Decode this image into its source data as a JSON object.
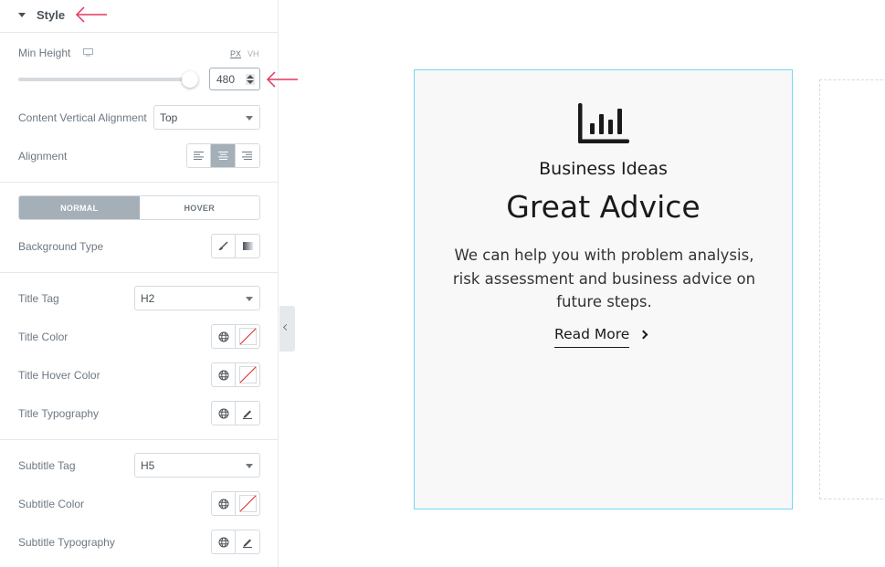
{
  "panel": {
    "section_title": "Style",
    "min_height": {
      "label": "Min Height",
      "units": [
        "PX",
        "VH"
      ],
      "active_unit": "PX",
      "value": "480",
      "slider_fraction": 0.96
    },
    "content_vertical_alignment": {
      "label": "Content Vertical Alignment",
      "value": "Top"
    },
    "alignment": {
      "label": "Alignment",
      "options": [
        "left",
        "center",
        "right"
      ],
      "active": "center"
    },
    "state_tabs": {
      "items": [
        "NORMAL",
        "HOVER"
      ],
      "active": "NORMAL"
    },
    "background_type": {
      "label": "Background Type",
      "options": [
        "classic",
        "gradient"
      ]
    },
    "title_tag": {
      "label": "Title Tag",
      "value": "H2"
    },
    "title_color": {
      "label": "Title Color"
    },
    "title_hover_color": {
      "label": "Title Hover Color"
    },
    "title_typography": {
      "label": "Title Typography"
    },
    "subtitle_tag": {
      "label": "Subtitle Tag",
      "value": "H5"
    },
    "subtitle_color": {
      "label": "Subtitle Color"
    },
    "subtitle_typography": {
      "label": "Subtitle Typography"
    }
  },
  "preview": {
    "card": {
      "icon": "bar-chart-icon",
      "subtitle": "Business Ideas",
      "title": "Great Advice",
      "description": "We can help you with problem analysis, risk assessment and business advice on future steps.",
      "link_label": "Read More"
    }
  },
  "colors": {
    "accent_arrow": "#e2375b",
    "card_border": "#71d7f7",
    "active_control": "#a4afb7"
  }
}
